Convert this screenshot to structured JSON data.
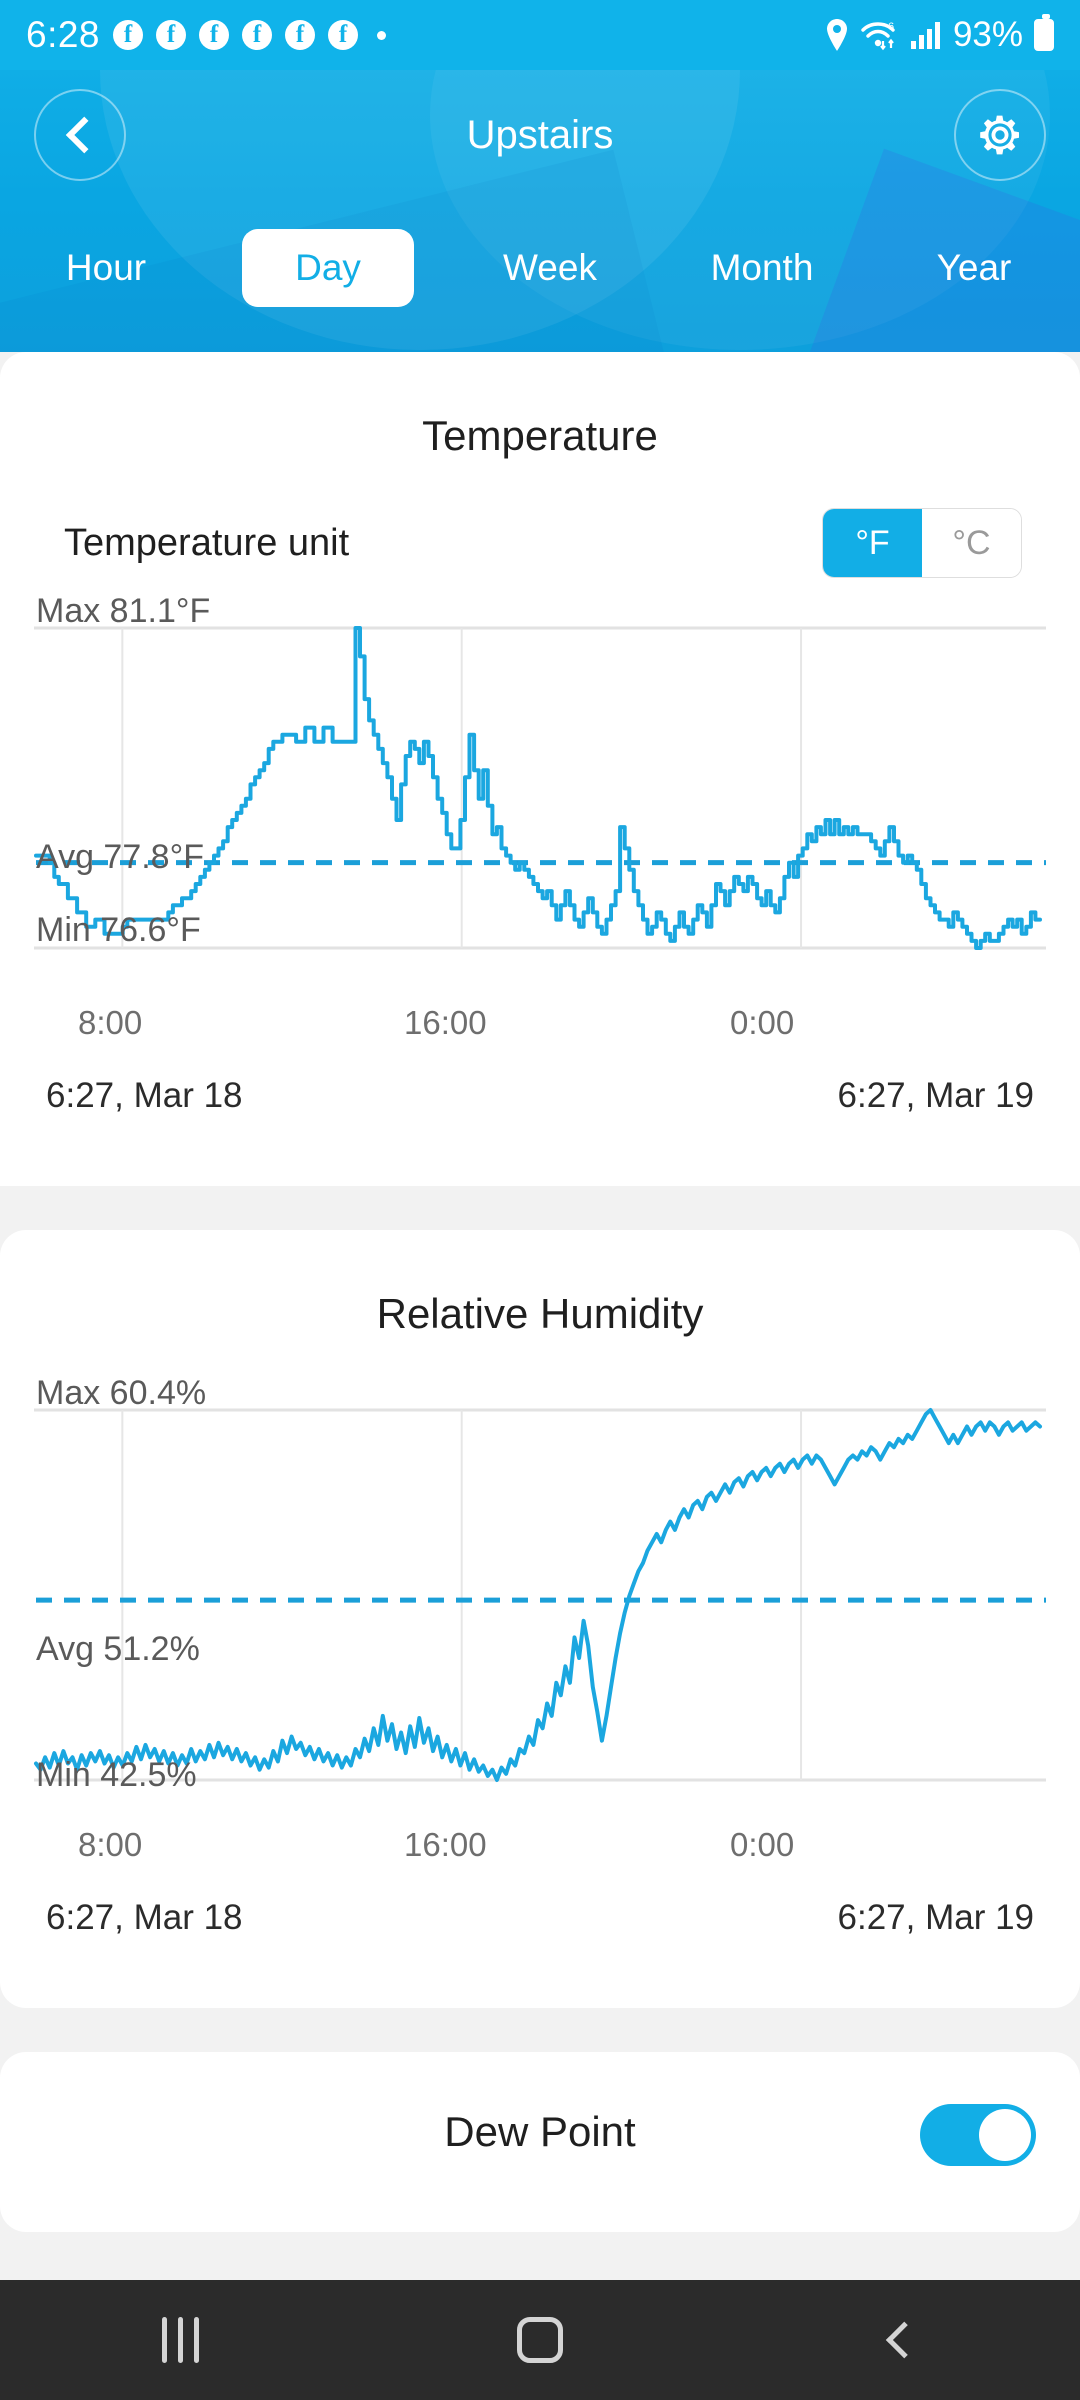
{
  "status_bar": {
    "time": "6:28",
    "notification_icons": [
      "facebook-icon",
      "facebook-icon",
      "facebook-icon",
      "facebook-icon",
      "facebook-icon",
      "facebook-icon"
    ],
    "more_dot": "•",
    "location_icon": "location-pin-icon",
    "wifi_icon": "wifi-6-icon",
    "signal_icon": "cellular-signal-icon",
    "battery_percent": "93%",
    "battery_icon": "battery-icon"
  },
  "header": {
    "title": "Upstairs",
    "back_icon": "back-chevron-icon",
    "settings_icon": "gear-icon"
  },
  "tabs": {
    "items": [
      {
        "label": "Hour",
        "active": false
      },
      {
        "label": "Day",
        "active": true
      },
      {
        "label": "Week",
        "active": false
      },
      {
        "label": "Month",
        "active": false
      },
      {
        "label": "Year",
        "active": false
      }
    ]
  },
  "temperature_card": {
    "title": "Temperature",
    "unit_label": "Temperature unit",
    "unit_options": [
      {
        "label": "°F",
        "selected": true
      },
      {
        "label": "°C",
        "selected": false
      }
    ],
    "max_label": "Max 81.1°F",
    "avg_label": "Avg 77.8°F",
    "min_label": "Min 76.6°F",
    "x_ticks": [
      "8:00",
      "16:00",
      "0:00"
    ],
    "range_start": "6:27,  Mar 18",
    "range_end": "6:27,  Mar 19"
  },
  "humidity_card": {
    "title": "Relative Humidity",
    "max_label": "Max 60.4%",
    "avg_label": "Avg 51.2%",
    "min_label": "Min 42.5%",
    "x_ticks": [
      "8:00",
      "16:00",
      "0:00"
    ],
    "range_start": "6:27,  Mar 18",
    "range_end": "6:27,  Mar 19"
  },
  "dew_point_card": {
    "title": "Dew Point",
    "toggle_on": true
  },
  "nav_bar": {
    "recents_icon": "recents-icon",
    "home_icon": "home-icon",
    "back_icon": "back-icon"
  },
  "colors": {
    "accent": "#12aee6",
    "header_blue": "#0aa6e2",
    "line": "#1ba7e0",
    "card_bg": "#ffffff",
    "page_bg": "#f2f2f2",
    "nav_bg": "#2b2b2b"
  },
  "chart_data": [
    {
      "id": "temperature",
      "type": "line",
      "title": "Temperature",
      "ylabel": "°F",
      "xlabel": "",
      "unit": "°F",
      "ylim": [
        76.6,
        81.1
      ],
      "stats": {
        "max": 81.1,
        "avg": 77.8,
        "min": 76.6
      },
      "avg_line": 77.8,
      "grid": true,
      "x_tick_labels": [
        "8:00",
        "16:00",
        "0:00"
      ],
      "x_tick_positions": [
        0.086,
        0.424,
        0.762
      ],
      "x_range": [
        "6:27, Mar 18",
        "6:27, Mar 19"
      ],
      "values": [
        77.9,
        77.9,
        77.9,
        77.8,
        77.6,
        77.5,
        77.5,
        77.3,
        77.3,
        77.1,
        77.1,
        76.9,
        76.9,
        77.0,
        77.0,
        76.8,
        76.8,
        76.8,
        76.8,
        76.9,
        77.0,
        77.0,
        77.0,
        77.0,
        77.0,
        77.0,
        77.0,
        77.0,
        77.0,
        77.1,
        77.2,
        77.2,
        77.3,
        77.3,
        77.4,
        77.5,
        77.6,
        77.7,
        77.8,
        77.9,
        78.0,
        78.1,
        78.3,
        78.4,
        78.5,
        78.6,
        78.7,
        78.9,
        79.0,
        79.1,
        79.2,
        79.4,
        79.5,
        79.5,
        79.6,
        79.6,
        79.6,
        79.5,
        79.5,
        79.7,
        79.7,
        79.5,
        79.5,
        79.7,
        79.7,
        79.5,
        79.5,
        79.5,
        79.5,
        79.5,
        81.1,
        80.7,
        80.1,
        79.8,
        79.6,
        79.4,
        79.2,
        79.0,
        78.7,
        78.4,
        78.9,
        79.3,
        79.5,
        79.4,
        79.2,
        79.5,
        79.3,
        79.0,
        78.7,
        78.5,
        78.2,
        78.0,
        78.0,
        78.4,
        79.0,
        79.6,
        79.1,
        78.7,
        79.1,
        78.6,
        78.2,
        78.3,
        78.0,
        77.9,
        77.8,
        77.7,
        77.8,
        77.7,
        77.6,
        77.5,
        77.4,
        77.3,
        77.4,
        77.2,
        77.0,
        77.2,
        77.4,
        77.2,
        77.0,
        76.9,
        77.1,
        77.3,
        77.1,
        76.9,
        76.8,
        77.0,
        77.2,
        77.4,
        78.3,
        78.0,
        77.7,
        77.4,
        77.2,
        77.0,
        76.8,
        76.9,
        77.1,
        77.0,
        76.8,
        76.7,
        76.9,
        77.1,
        76.9,
        76.8,
        77.0,
        77.2,
        77.1,
        76.9,
        77.2,
        77.5,
        77.4,
        77.2,
        77.4,
        77.6,
        77.5,
        77.4,
        77.6,
        77.5,
        77.3,
        77.2,
        77.4,
        77.2,
        77.1,
        77.3,
        77.6,
        77.8,
        77.6,
        77.9,
        78.0,
        78.2,
        78.1,
        78.3,
        78.2,
        78.4,
        78.2,
        78.4,
        78.2,
        78.3,
        78.2,
        78.3,
        78.2,
        78.2,
        78.2,
        78.1,
        78.0,
        77.9,
        78.1,
        78.3,
        78.1,
        77.9,
        77.8,
        77.9,
        77.8,
        77.7,
        77.5,
        77.3,
        77.2,
        77.1,
        77.0,
        77.0,
        76.9,
        77.1,
        77.0,
        76.9,
        76.8,
        76.7,
        76.6,
        76.7,
        76.8,
        76.7,
        76.7,
        76.8,
        76.9,
        77.0,
        76.9,
        77.0,
        76.8,
        76.9,
        77.1,
        77.0,
        77.0
      ]
    },
    {
      "id": "relative_humidity",
      "type": "line",
      "title": "Relative Humidity",
      "ylabel": "%",
      "xlabel": "",
      "unit": "%",
      "ylim": [
        42.5,
        60.4
      ],
      "stats": {
        "max": 60.4,
        "avg": 51.2,
        "min": 42.5
      },
      "avg_line": 51.2,
      "grid": true,
      "x_tick_labels": [
        "8:00",
        "16:00",
        "0:00"
      ],
      "x_tick_positions": [
        0.086,
        0.424,
        0.762
      ],
      "x_range": [
        "6:27, Mar 18",
        "6:27, Mar 19"
      ],
      "values": [
        43.3,
        43.0,
        43.6,
        43.1,
        43.8,
        43.2,
        43.9,
        43.3,
        43.6,
        43.0,
        43.7,
        43.2,
        43.8,
        43.4,
        43.9,
        43.3,
        43.7,
        43.1,
        43.6,
        43.2,
        43.8,
        43.4,
        44.1,
        43.5,
        44.2,
        43.6,
        44.0,
        43.4,
        43.9,
        43.3,
        43.8,
        43.2,
        43.7,
        43.3,
        44.0,
        43.4,
        43.9,
        43.5,
        44.2,
        43.6,
        44.3,
        43.7,
        44.1,
        43.5,
        44.0,
        43.4,
        43.8,
        43.2,
        43.6,
        43.0,
        43.5,
        43.1,
        43.9,
        43.4,
        44.4,
        43.8,
        44.6,
        44.0,
        44.3,
        43.7,
        44.1,
        43.5,
        44.0,
        43.4,
        43.8,
        43.2,
        43.7,
        43.1,
        43.6,
        43.2,
        44.0,
        43.6,
        44.5,
        43.9,
        45.0,
        44.2,
        45.6,
        44.4,
        45.2,
        44.0,
        44.8,
        43.8,
        45.1,
        44.1,
        45.5,
        44.3,
        45.0,
        43.9,
        44.6,
        43.6,
        44.2,
        43.4,
        44.0,
        43.2,
        43.8,
        43.0,
        43.5,
        42.9,
        43.2,
        42.7,
        43.0,
        42.5,
        43.1,
        42.8,
        43.5,
        43.2,
        44.0,
        43.8,
        44.6,
        44.2,
        45.4,
        45.0,
        46.2,
        45.6,
        47.2,
        46.6,
        48.0,
        47.2,
        49.4,
        48.4,
        50.2,
        49.0,
        47.0,
        45.8,
        44.4,
        45.6,
        47.0,
        48.4,
        49.6,
        50.6,
        51.4,
        52.0,
        52.6,
        53.0,
        53.6,
        54.0,
        54.4,
        54.0,
        54.6,
        55.0,
        54.6,
        55.2,
        55.6,
        55.2,
        55.8,
        56.0,
        55.6,
        56.2,
        56.4,
        56.0,
        56.4,
        56.8,
        56.4,
        56.9,
        57.1,
        56.7,
        57.2,
        57.4,
        57.0,
        57.4,
        57.6,
        57.2,
        57.6,
        57.8,
        57.4,
        57.8,
        58.0,
        57.6,
        58.0,
        58.2,
        57.8,
        58.2,
        58.0,
        57.6,
        57.2,
        56.8,
        57.2,
        57.6,
        58.0,
        58.2,
        58.0,
        58.4,
        58.2,
        58.6,
        58.4,
        58.0,
        58.4,
        58.8,
        58.6,
        59.0,
        58.8,
        59.2,
        59.0,
        59.4,
        59.8,
        60.2,
        60.4,
        60.0,
        59.6,
        59.2,
        58.8,
        59.2,
        58.8,
        59.2,
        59.6,
        59.2,
        59.6,
        59.8,
        59.4,
        59.8,
        59.6,
        59.2,
        59.6,
        59.8,
        59.4,
        59.6,
        59.8,
        59.4,
        59.6,
        59.8,
        59.6
      ]
    }
  ]
}
